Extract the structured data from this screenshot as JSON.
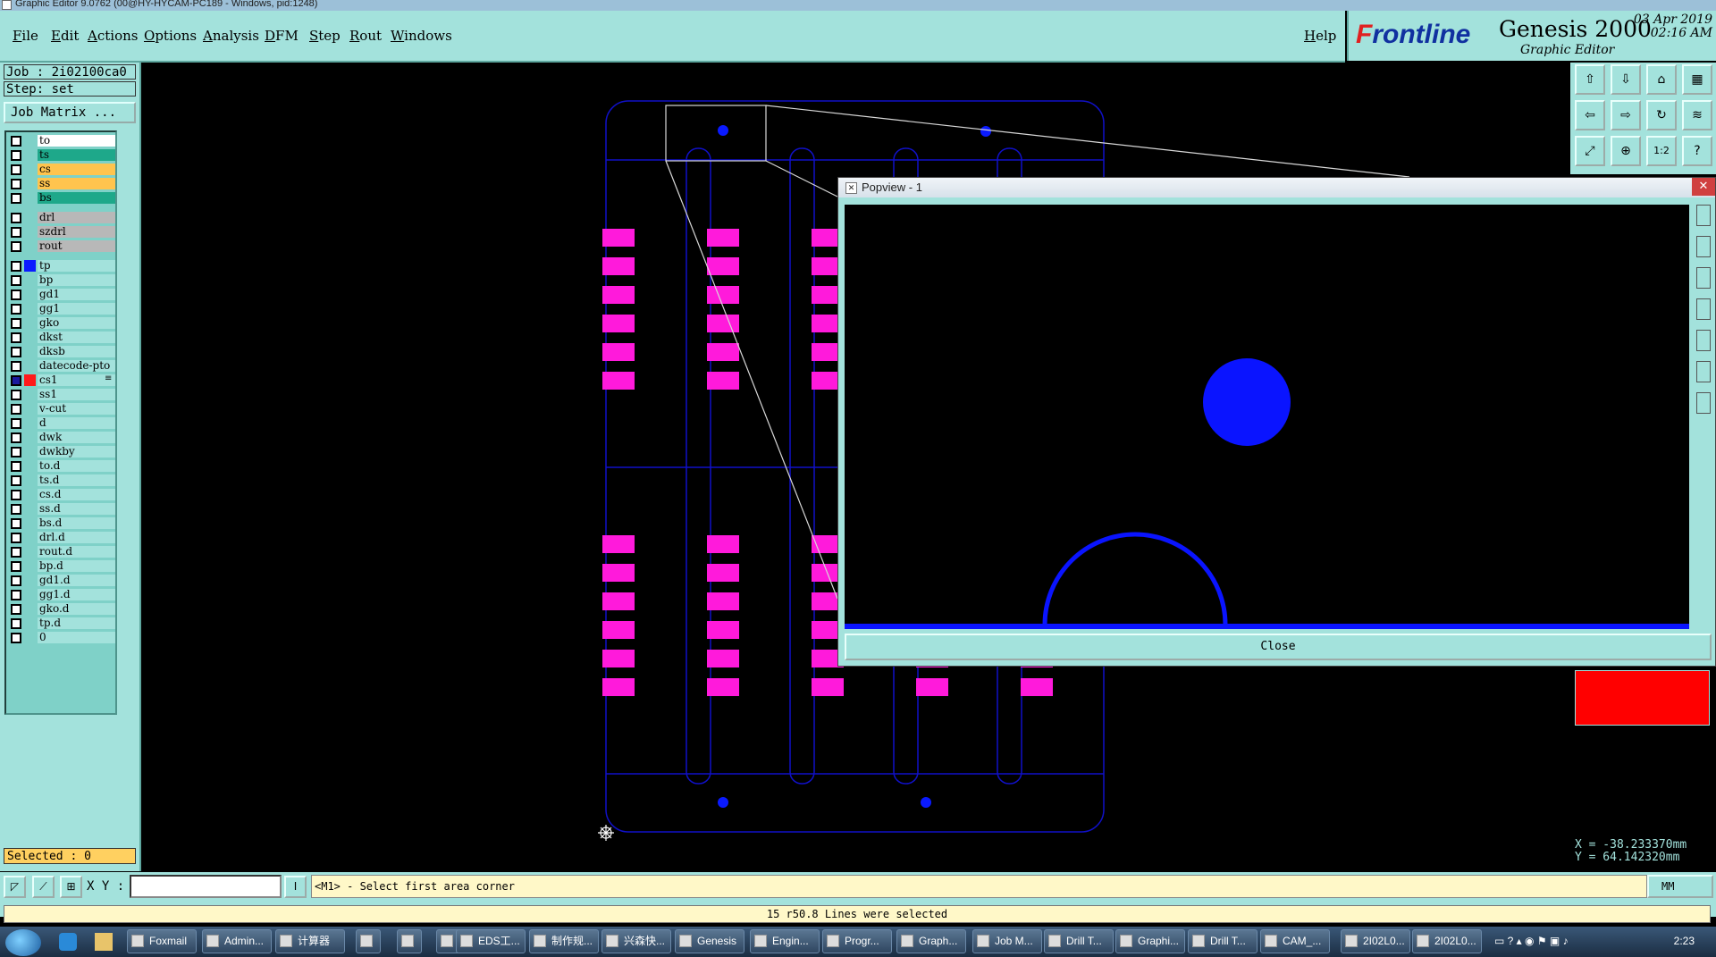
{
  "window": {
    "title": "Graphic Editor 9.0762 (00@HY-HYCAM-PC189 - Windows, pid:1248)"
  },
  "menu": {
    "items": [
      "File",
      "Edit",
      "Actions",
      "Options",
      "Analysis",
      "DFM",
      "Step",
      "Rout",
      "Windows"
    ],
    "help": "Help"
  },
  "brand": {
    "logo_f": "F",
    "logo_rest": "rontline",
    "product": "Genesis 2000",
    "subtitle": "Graphic Editor",
    "date": "03 Apr 2019",
    "time": "02:16 AM"
  },
  "job": {
    "job_line": "Job : 2i02100ca0",
    "step_line": "Step: set",
    "matrix_button": "Job Matrix ..."
  },
  "layers": [
    {
      "name": "to",
      "color": "#ffffff",
      "group": 0
    },
    {
      "name": "ts",
      "color": "#1ea88a",
      "group": 0
    },
    {
      "name": "cs",
      "color": "#ffc44e",
      "group": 0
    },
    {
      "name": "ss",
      "color": "#ffc44e",
      "group": 0
    },
    {
      "name": "bs",
      "color": "#1ea88a",
      "group": 0
    },
    {
      "name": "drl",
      "color": "#b8b8b8",
      "group": 1
    },
    {
      "name": "szdrl",
      "color": "#b8b8b8",
      "group": 1
    },
    {
      "name": "rout",
      "color": "#b8b8b8",
      "group": 1
    },
    {
      "name": "tp",
      "color": "#a3e2dc",
      "group": 2,
      "swatch": "#0a1aff"
    },
    {
      "name": "bp",
      "color": "#a3e2dc",
      "group": 2
    },
    {
      "name": "gd1",
      "color": "#a3e2dc",
      "group": 2
    },
    {
      "name": "gg1",
      "color": "#a3e2dc",
      "group": 2
    },
    {
      "name": "gko",
      "color": "#a3e2dc",
      "group": 2
    },
    {
      "name": "dkst",
      "color": "#a3e2dc",
      "group": 2
    },
    {
      "name": "dksb",
      "color": "#a3e2dc",
      "group": 2
    },
    {
      "name": "datecode-pto",
      "color": "#a3e2dc",
      "group": 2
    },
    {
      "name": "cs1",
      "color": "#a3e2dc",
      "group": 2,
      "swatch": "#ff1a1a",
      "active": true,
      "marker": "≡"
    },
    {
      "name": "ss1",
      "color": "#a3e2dc",
      "group": 2
    },
    {
      "name": "v-cut",
      "color": "#a3e2dc",
      "group": 2
    },
    {
      "name": "d",
      "color": "#a3e2dc",
      "group": 2
    },
    {
      "name": "dwk",
      "color": "#a3e2dc",
      "group": 2
    },
    {
      "name": "dwkby",
      "color": "#a3e2dc",
      "group": 2
    },
    {
      "name": "to.d",
      "color": "#a3e2dc",
      "group": 2
    },
    {
      "name": "ts.d",
      "color": "#a3e2dc",
      "group": 2
    },
    {
      "name": "cs.d",
      "color": "#a3e2dc",
      "group": 2
    },
    {
      "name": "ss.d",
      "color": "#a3e2dc",
      "group": 2
    },
    {
      "name": "bs.d",
      "color": "#a3e2dc",
      "group": 2
    },
    {
      "name": "drl.d",
      "color": "#a3e2dc",
      "group": 2
    },
    {
      "name": "rout.d",
      "color": "#a3e2dc",
      "group": 2
    },
    {
      "name": "bp.d",
      "color": "#a3e2dc",
      "group": 2
    },
    {
      "name": "gd1.d",
      "color": "#a3e2dc",
      "group": 2
    },
    {
      "name": "gg1.d",
      "color": "#a3e2dc",
      "group": 2
    },
    {
      "name": "gko.d",
      "color": "#a3e2dc",
      "group": 2
    },
    {
      "name": "tp.d",
      "color": "#a3e2dc",
      "group": 2
    },
    {
      "name": "0",
      "color": "#a3e2dc",
      "group": 2
    }
  ],
  "selected_label": "Selected : 0",
  "coords": {
    "x": "X = -38.233370mm",
    "y": "Y = 64.142320mm"
  },
  "bottom": {
    "xy_label": "X Y :",
    "xy_value": "",
    "prompt": "<M1> - Select first area corner",
    "units": "MM",
    "status": "15 r50.8 Lines were selected"
  },
  "right_tools": [
    "1:2",
    "?"
  ],
  "popview": {
    "title": "Popview - 1",
    "close_label": "Close"
  },
  "taskbar": {
    "items": [
      "Foxmail",
      "Admin...",
      "计算器",
      "",
      "",
      "",
      "EDS工...",
      "制作规...",
      "兴森快...",
      "Genesis",
      "Engin...",
      "Progr...",
      "Graph...",
      "Job M...",
      "Drill T...",
      "Graphi...",
      "Drill T...",
      "CAM_...",
      "2I02L0...",
      "2I02L0..."
    ],
    "clock": "2:23"
  },
  "colors": {
    "panel": "#a3e2dc",
    "pad": "#ff1adb",
    "outline": "#1010c8",
    "popview_shape": "#0a14ff",
    "canvas": "#000000"
  }
}
